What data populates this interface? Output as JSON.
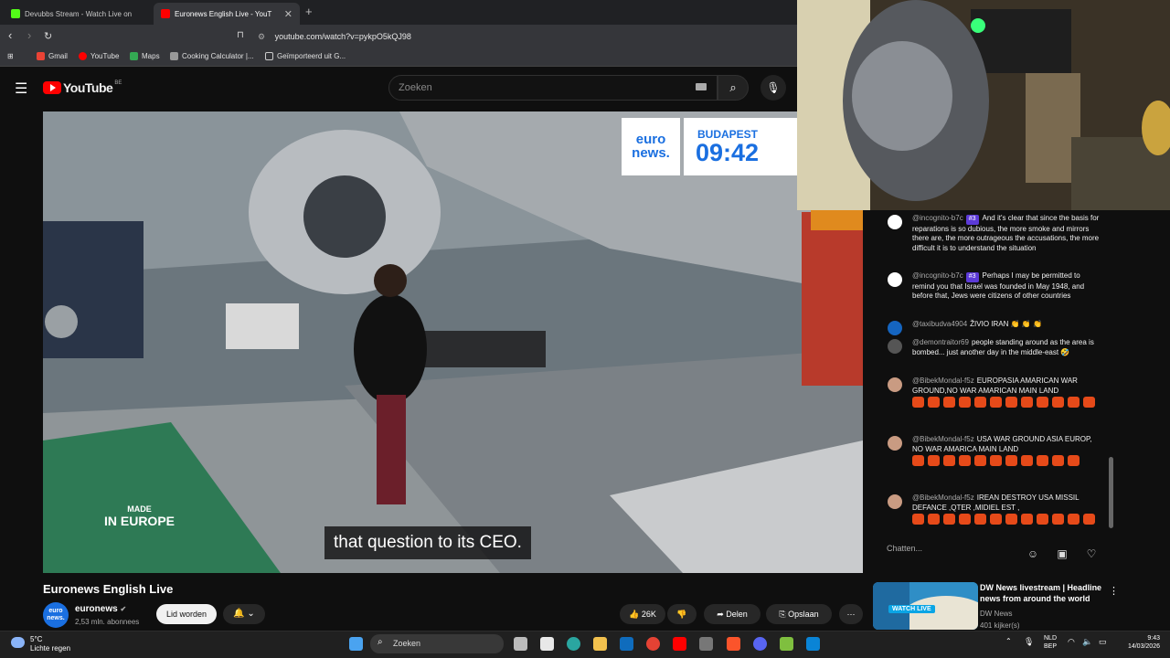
{
  "browser": {
    "tabs": [
      {
        "label": "Devubbs Stream - Watch Live on"
      },
      {
        "label": "Euronews English Live - YouT"
      }
    ],
    "url": "youtube.com/watch?v=pykpO5kQJ98",
    "bookmarks": [
      "Gmail",
      "YouTube",
      "Maps",
      "Cooking Calculator |...",
      "Geïmporteerd uit G..."
    ]
  },
  "youtube": {
    "logo": "YouTube",
    "country": "BE",
    "search_placeholder": "Zoeken"
  },
  "video": {
    "caption": "that question to its CEO.",
    "brand": "euro news.",
    "city": "BUDAPEST",
    "time": "09:42",
    "made_in_1": "MADE",
    "made_in_2": "IN EUROPE"
  },
  "chat": {
    "messages": [
      {
        "author": "@incognito-b7c",
        "badge": "#3",
        "text": "And it's clear that since the basis for reparations is so dubious, the more smoke and mirrors there are, the more outrageous the accusations, the more difficult it is to understand the situation"
      },
      {
        "author": "@incognito-b7c",
        "badge": "#3",
        "text": "Perhaps I may be permitted to remind you that Israel was founded in May 1948, and before that, Jews were citizens of other countries"
      },
      {
        "author": "@taxibudva4904",
        "text": "ŽIVIO IRAN 👏 👏 👏"
      },
      {
        "author": "@demontraitor69",
        "text": "people standing around as the area is bombed... just another day in the middle-east 🤣"
      },
      {
        "author": "@BibekMondal-f5z",
        "text": "EUROPASIA AMARICAN WAR GROUND,NO WAR AMARICAN MAIN LAND",
        "emotes": 12
      },
      {
        "author": "@BibekMondal-f5z",
        "text": "USA WAR GROUND ASIA EUROP, NO WAR AMARICA MAIN LAND",
        "emotes": 11
      },
      {
        "author": "@BibekMondal-f5z",
        "text": "IREAN DESTROY USA MISSIL DEFANCE ,QTER ,MIDIEL EST ,",
        "emotes": 12
      }
    ],
    "input_placeholder": "Chatten..."
  },
  "meta": {
    "title": "Euronews English Live",
    "channel": "euronews",
    "channel_avatar": "euro news.",
    "subscribers": "2,53 mln. abonnees",
    "join": "Lid worden",
    "likes": "26K",
    "share": "Delen",
    "save": "Opslaan"
  },
  "recommendation": {
    "title": "DW News livestream | Headline news from around the world",
    "channel": "DW News",
    "viewers": "401 kijker(s)",
    "badge": "WATCH LIVE"
  },
  "taskbar": {
    "temp": "5°C",
    "weather": "Lichte regen",
    "search": "Zoeken",
    "lang1": "NLD",
    "lang2": "BEP",
    "time": "9:43",
    "date": "14/03/2026"
  },
  "colors": {
    "yt_red": "#ff0000",
    "euronews_blue": "#1a6fe0",
    "badge_purple": "#5c3ad7"
  }
}
